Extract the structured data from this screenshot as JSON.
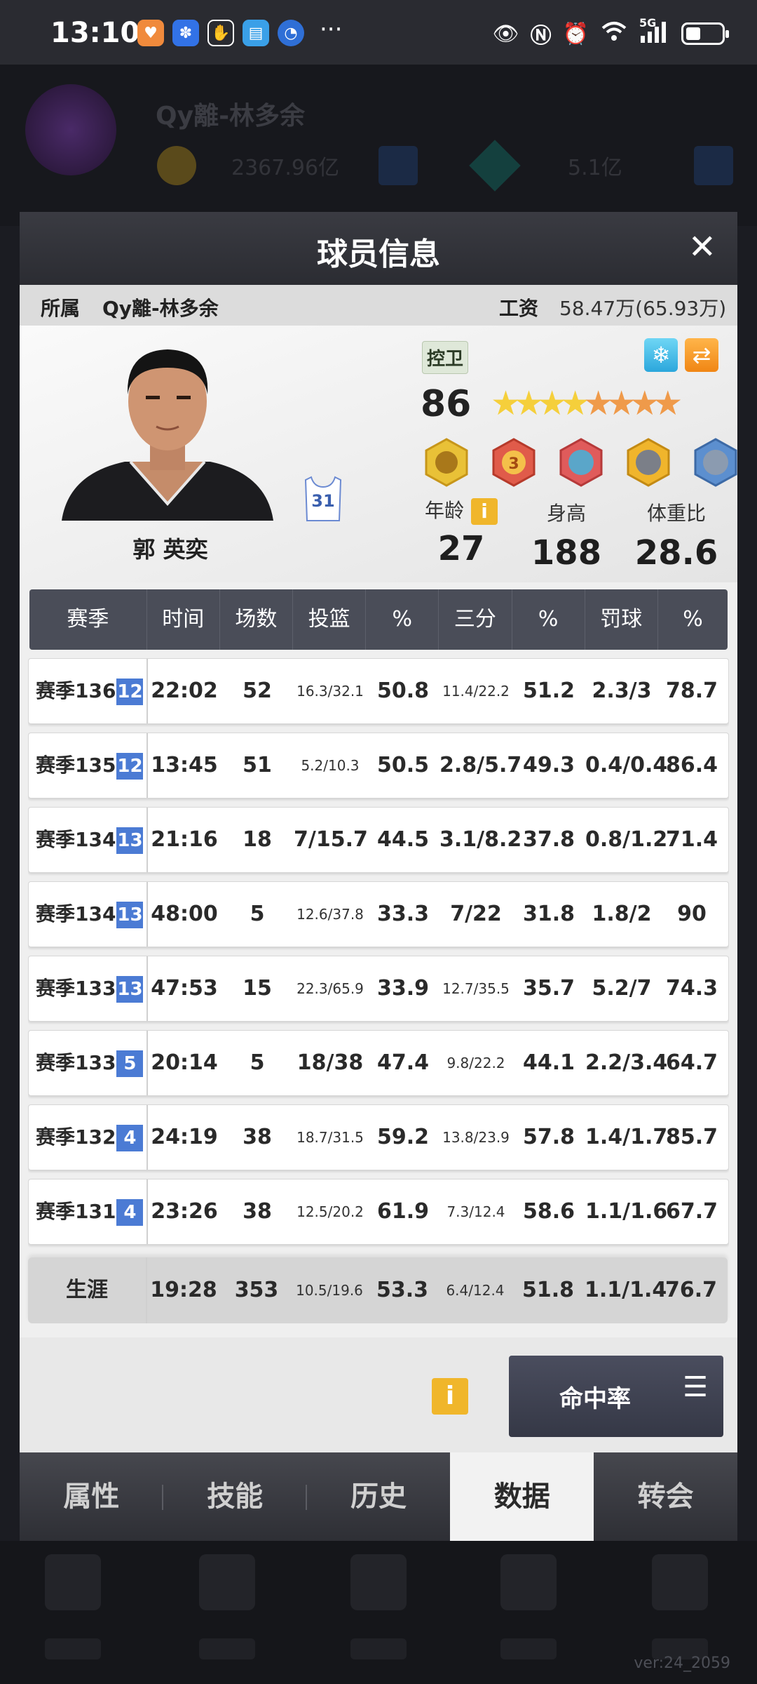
{
  "status": {
    "time": "13:10",
    "more": "···",
    "net": "5G"
  },
  "background": {
    "player": "Qy離-林多余",
    "coins": "2367.96亿",
    "gems": "5.1亿",
    "version": "ver:24_2059"
  },
  "dialog": {
    "title": "球员信息",
    "close": "✕",
    "team_label": "所属",
    "team_name": "Qy離-林多余",
    "salary_label": "工资",
    "salary_value": "58.47万(65.93万)",
    "player_name": "郭 英奕",
    "jersey_number": "31",
    "position": "控卫",
    "rating": "86",
    "age_label": "年龄",
    "age": "27",
    "height_label": "身高",
    "height": "188",
    "weight_label": "体重比",
    "weight": "28.6",
    "info_glyph": "i"
  },
  "table": {
    "headers": [
      "赛季",
      "时间",
      "场数",
      "投篮",
      "%",
      "三分",
      "%",
      "罚球",
      "%"
    ],
    "rows": [
      {
        "season": "赛季136",
        "lvl": "12",
        "time": "22:02",
        "games": "52",
        "fg": "16.3/32.1",
        "fgp": "50.8",
        "tp": "11.4/22.2",
        "tpp": "51.2",
        "ft": "2.3/3",
        "ftp": "78.7"
      },
      {
        "season": "赛季135",
        "lvl": "12",
        "time": "13:45",
        "games": "51",
        "fg": "5.2/10.3",
        "fgp": "50.5",
        "tp": "2.8/5.7",
        "tpp": "49.3",
        "ft": "0.4/0.4",
        "ftp": "86.4"
      },
      {
        "season": "赛季134",
        "lvl": "13",
        "time": "21:16",
        "games": "18",
        "fg": "7/15.7",
        "fgp": "44.5",
        "tp": "3.1/8.2",
        "tpp": "37.8",
        "ft": "0.8/1.2",
        "ftp": "71.4"
      },
      {
        "season": "赛季134",
        "lvl": "13",
        "time": "48:00",
        "games": "5",
        "fg": "12.6/37.8",
        "fgp": "33.3",
        "tp": "7/22",
        "tpp": "31.8",
        "ft": "1.8/2",
        "ftp": "90"
      },
      {
        "season": "赛季133",
        "lvl": "13",
        "time": "47:53",
        "games": "15",
        "fg": "22.3/65.9",
        "fgp": "33.9",
        "tp": "12.7/35.5",
        "tpp": "35.7",
        "ft": "5.2/7",
        "ftp": "74.3"
      },
      {
        "season": "赛季133",
        "lvl": "5",
        "time": "20:14",
        "games": "5",
        "fg": "18/38",
        "fgp": "47.4",
        "tp": "9.8/22.2",
        "tpp": "44.1",
        "ft": "2.2/3.4",
        "ftp": "64.7"
      },
      {
        "season": "赛季132",
        "lvl": "4",
        "time": "24:19",
        "games": "38",
        "fg": "18.7/31.5",
        "fgp": "59.2",
        "tp": "13.8/23.9",
        "tpp": "57.8",
        "ft": "1.4/1.7",
        "ftp": "85.7"
      },
      {
        "season": "赛季131",
        "lvl": "4",
        "time": "23:26",
        "games": "38",
        "fg": "12.5/20.2",
        "fgp": "61.9",
        "tp": "7.3/12.4",
        "tpp": "58.6",
        "ft": "1.1/1.6",
        "ftp": "67.7"
      }
    ],
    "career": {
      "label": "生涯",
      "time": "19:28",
      "games": "353",
      "fg": "10.5/19.6",
      "fgp": "53.3",
      "tp": "6.4/12.4",
      "tpp": "51.8",
      "ft": "1.1/1.4",
      "ftp": "76.7"
    }
  },
  "footer": {
    "info": "i",
    "sort_button": "命中率",
    "menu_glyph": "☰"
  },
  "tabs": [
    "属性",
    "技能",
    "历史",
    "数据",
    "转会"
  ]
}
